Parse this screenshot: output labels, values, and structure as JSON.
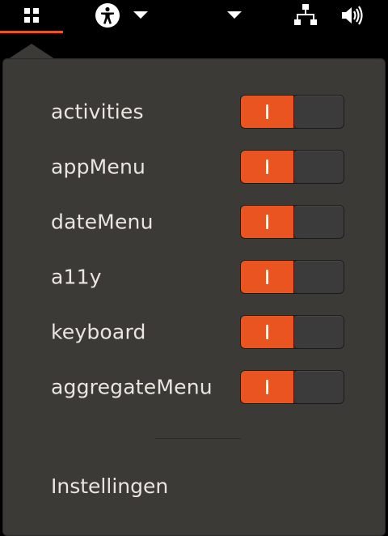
{
  "topbar": {
    "icons": [
      "apps-grid-icon",
      "accessibility-icon",
      "chevron-down-icon",
      "chevron-down-icon",
      "network-icon",
      "volume-icon"
    ]
  },
  "colors": {
    "accent": "#e95420",
    "menu_bg": "#3b3a36",
    "text": "#e9e6e0"
  },
  "menu": {
    "items": [
      {
        "label": "activities",
        "toggle": true
      },
      {
        "label": "appMenu",
        "toggle": true
      },
      {
        "label": "dateMenu",
        "toggle": true
      },
      {
        "label": "a11y",
        "toggle": true
      },
      {
        "label": "keyboard",
        "toggle": true
      },
      {
        "label": "aggregateMenu",
        "toggle": true
      }
    ],
    "settings_label": "Instellingen"
  }
}
